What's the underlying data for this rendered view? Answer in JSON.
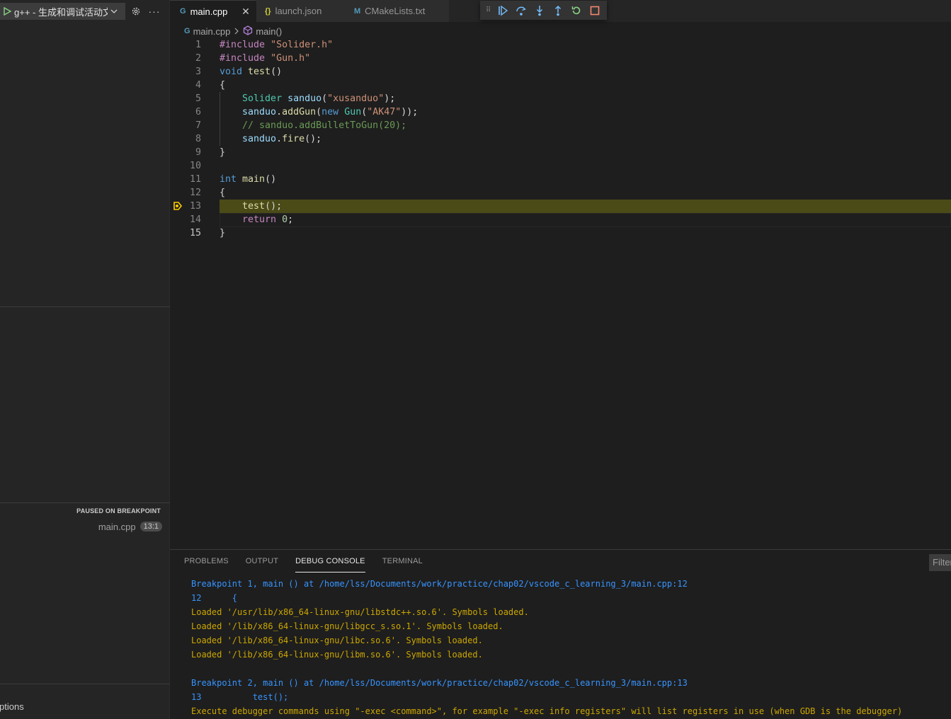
{
  "run": {
    "config_label": "g++ - 生成和调试活动文件"
  },
  "sidebar": {
    "call_stack_header": "PAUSED ON BREAKPOINT",
    "frame_file": "main.cpp",
    "frame_pos": "13:1",
    "breakpoints_label": "ptions"
  },
  "tabs": [
    {
      "label": "main.cpp",
      "icon": "G",
      "active": true
    },
    {
      "label": "launch.json",
      "icon": "{}"
    },
    {
      "label": "CMakeLists.txt",
      "icon": "M"
    }
  ],
  "breadcrumb": {
    "file": "main.cpp",
    "symbol": "main()"
  },
  "editor": {
    "current_line": 13,
    "lines": [
      {
        "n": "1",
        "tokens": [
          [
            "ctl",
            "#include "
          ],
          [
            "str",
            "\"Solider.h\""
          ]
        ]
      },
      {
        "n": "2",
        "tokens": [
          [
            "ctl",
            "#include "
          ],
          [
            "str",
            "\"Gun.h\""
          ]
        ]
      },
      {
        "n": "3",
        "tokens": [
          [
            "kw",
            "void "
          ],
          [
            "fn",
            "test"
          ],
          [
            "plain",
            "()"
          ]
        ]
      },
      {
        "n": "4",
        "tokens": [
          [
            "plain",
            "{"
          ]
        ]
      },
      {
        "n": "5",
        "tokens": [
          [
            "plain",
            "    "
          ],
          [
            "typ",
            "Solider "
          ],
          [
            "var",
            "sanduo"
          ],
          [
            "plain",
            "("
          ],
          [
            "str",
            "\"xusanduo\""
          ],
          [
            "plain",
            ");"
          ]
        ]
      },
      {
        "n": "6",
        "tokens": [
          [
            "plain",
            "    "
          ],
          [
            "var",
            "sanduo"
          ],
          [
            "plain",
            "."
          ],
          [
            "fn",
            "addGun"
          ],
          [
            "plain",
            "("
          ],
          [
            "kw",
            "new "
          ],
          [
            "typ",
            "Gun"
          ],
          [
            "plain",
            "("
          ],
          [
            "str",
            "\"AK47\""
          ],
          [
            "plain",
            "));"
          ]
        ]
      },
      {
        "n": "7",
        "tokens": [
          [
            "plain",
            "    "
          ],
          [
            "cmt",
            "// sanduo.addBulletToGun(20);"
          ]
        ]
      },
      {
        "n": "8",
        "tokens": [
          [
            "plain",
            "    "
          ],
          [
            "var",
            "sanduo"
          ],
          [
            "plain",
            "."
          ],
          [
            "fn",
            "fire"
          ],
          [
            "plain",
            "();"
          ]
        ]
      },
      {
        "n": "9",
        "tokens": [
          [
            "plain",
            "}"
          ]
        ]
      },
      {
        "n": "10",
        "tokens": []
      },
      {
        "n": "11",
        "tokens": [
          [
            "kw",
            "int "
          ],
          [
            "fn",
            "main"
          ],
          [
            "plain",
            "()"
          ]
        ]
      },
      {
        "n": "12",
        "tokens": [
          [
            "plain",
            "{"
          ]
        ]
      },
      {
        "n": "13",
        "tokens": [
          [
            "plain",
            "    "
          ],
          [
            "fn",
            "test"
          ],
          [
            "plain",
            "();"
          ]
        ]
      },
      {
        "n": "14",
        "tokens": [
          [
            "plain",
            "    "
          ],
          [
            "ctl",
            "return "
          ],
          [
            "num",
            "0"
          ],
          [
            "plain",
            ";"
          ]
        ]
      },
      {
        "n": "15",
        "tokens": [
          [
            "plain",
            "}"
          ]
        ]
      }
    ]
  },
  "panel": {
    "tabs": [
      "PROBLEMS",
      "OUTPUT",
      "DEBUG CONSOLE",
      "TERMINAL"
    ],
    "active_tab": "DEBUG CONSOLE",
    "filter_placeholder": "Filter",
    "console_lines": [
      {
        "color": "blue",
        "text": "Breakpoint 1, main () at /home/lss/Documents/work/practice/chap02/vscode_c_learning_3/main.cpp:12"
      },
      {
        "color": "blue",
        "text": "12\t{"
      },
      {
        "color": "yellow",
        "text": "Loaded '/usr/lib/x86_64-linux-gnu/libstdc++.so.6'. Symbols loaded."
      },
      {
        "color": "yellow",
        "text": "Loaded '/lib/x86_64-linux-gnu/libgcc_s.so.1'. Symbols loaded."
      },
      {
        "color": "yellow",
        "text": "Loaded '/lib/x86_64-linux-gnu/libc.so.6'. Symbols loaded."
      },
      {
        "color": "yellow",
        "text": "Loaded '/lib/x86_64-linux-gnu/libm.so.6'. Symbols loaded."
      },
      {
        "color": "yellow",
        "text": ""
      },
      {
        "color": "blue",
        "text": "Breakpoint 2, main () at /home/lss/Documents/work/practice/chap02/vscode_c_learning_3/main.cpp:13"
      },
      {
        "color": "blue",
        "text": "13\t    test();"
      },
      {
        "color": "yellow",
        "text": "Execute debugger commands using \"-exec <command>\", for example \"-exec info registers\" will list registers in use (when GDB is the debugger)"
      }
    ]
  },
  "colors": {
    "accent": "#007acc",
    "current_line_bg": "#4b4b18",
    "breakpoint_marker": "#ffcc00",
    "console_blue": "#3794ff",
    "console_yellow": "#cca700"
  }
}
